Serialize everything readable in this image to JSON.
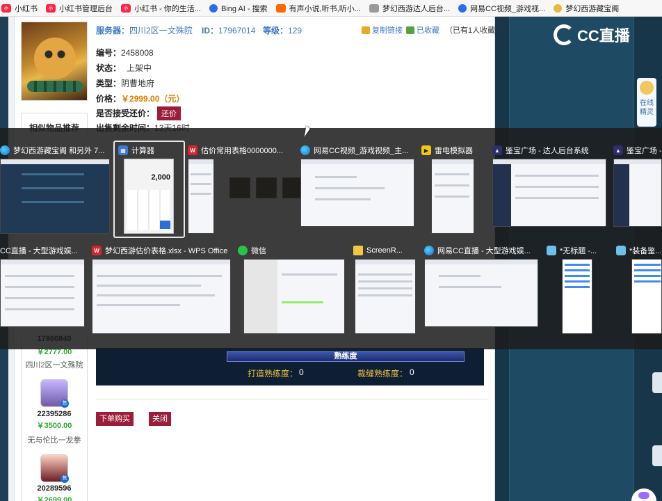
{
  "bookmarks": [
    {
      "icon": "redbook-icon",
      "label": "小红书"
    },
    {
      "icon": "redbook-icon",
      "label": "小红书管理后台"
    },
    {
      "icon": "redbook-icon",
      "label": "小红书 - 你的生活..."
    },
    {
      "icon": "bing-icon",
      "label": "Bing AI - 搜索"
    },
    {
      "icon": "novel-icon",
      "label": "有声小说,听书,听小..."
    },
    {
      "icon": "page-icon",
      "label": "梦幻西游达人后台..."
    },
    {
      "icon": "cc-icon",
      "label": "网易CC视频_游戏视..."
    },
    {
      "icon": "treasure-icon",
      "label": "梦幻西游藏宝阁"
    }
  ],
  "item": {
    "server_label": "服务器：",
    "server_value": "四川2区一文殊院",
    "id_label": "ID：",
    "id_value": "17967014",
    "level_label": "等级：",
    "level_value": "129",
    "copy_link": "复制链接",
    "favorited": "已收藏",
    "favorite_count": "（已有1人收藏）",
    "number_label": "编号：",
    "number_value": "2458008",
    "status_label": "状态：",
    "status_value": "上架中",
    "type_label": "类型：",
    "type_value": "阴曹地府",
    "price_label": "价格：",
    "price_value": "￥2999.00（元）",
    "bargain_label": "是否接受还价：",
    "bargain_button": "还价",
    "remaining_label": "出售剩余时间：",
    "remaining_value": "13天16时"
  },
  "similar": {
    "title": "相似物品推荐",
    "items": [
      {
        "id": "17960840",
        "price": "￥2777.00",
        "server": "四川2区一文殊院"
      },
      {
        "id": "22395286",
        "price": "￥3500.00",
        "server": "无与伦比一龙拳"
      },
      {
        "id": "20289596",
        "price": "￥2699.00",
        "server": ""
      }
    ]
  },
  "proficiency": {
    "title": "熟练度",
    "craft_label": "打造熟练度：",
    "craft_value": "0",
    "sew_label": "裁缝熟练度：",
    "sew_value": "0"
  },
  "actions": {
    "buy": "下单购买",
    "close": "关闭"
  },
  "right_panel": {
    "logo": "CC直播",
    "online_line1": "在线",
    "online_line2": "精灵"
  },
  "switcher": {
    "row1": [
      {
        "icon": "edge-icon",
        "title": "梦幻西游藏宝阁 和另外 7..."
      },
      {
        "icon": "calculator-icon",
        "title": "计算器"
      },
      {
        "icon": "wps-icon",
        "title": "估价常用表格0000000..."
      },
      {
        "icon": "edge-icon",
        "title": "网易CC视频_游戏视频_主..."
      },
      {
        "icon": "leidian-icon",
        "title": "雷电模拟器"
      },
      {
        "icon": "jianbao-icon",
        "title": "鉴宝广场 - 达人后台系统"
      },
      {
        "icon": "jianbao-icon",
        "title": "鉴宝广场 -"
      }
    ],
    "row2": [
      {
        "icon": "edge-icon",
        "title": "CC直播 - 大型游戏娱..."
      },
      {
        "icon": "wps-icon",
        "title": "梦幻西游估价表格.xlsx - WPS Office"
      },
      {
        "icon": "wechat-icon",
        "title": "微信"
      },
      {
        "icon": "folder-icon",
        "title": "ScreenR..."
      },
      {
        "icon": "edge-icon",
        "title": "网易CC直播 - 大型游戏娱..."
      },
      {
        "icon": "notepad-icon",
        "title": "*无标题 -..."
      },
      {
        "icon": "notepad-icon",
        "title": "*装备鉴..."
      }
    ],
    "calculator_display": "2,000"
  }
}
